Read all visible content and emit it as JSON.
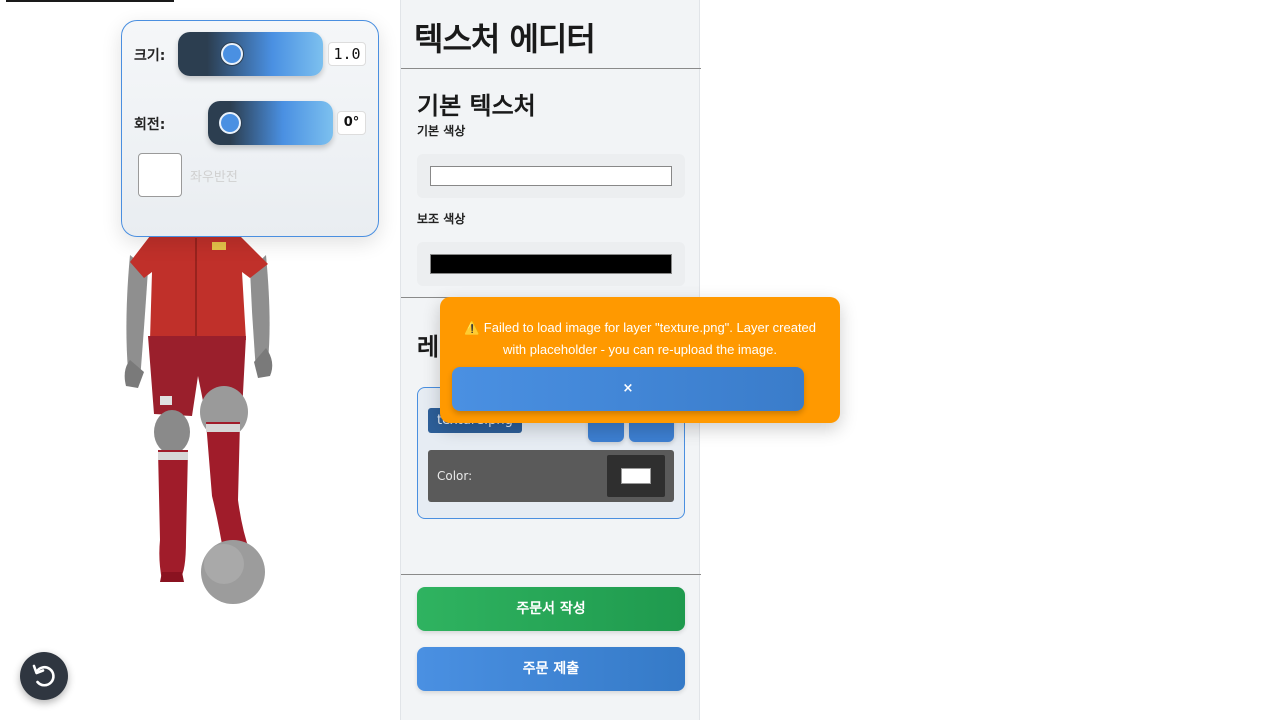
{
  "transform": {
    "size_label": "크기:",
    "size_value": "1.0",
    "rotation_label": "회전:",
    "rotation_value": "0°",
    "flip_label": "좌우반전",
    "size_level": 0.1,
    "rotation_level": 0.0
  },
  "editor": {
    "title": "텍스처 에디터",
    "base_section": {
      "title": "기본 텍스처",
      "primary_label": "기본 색상",
      "primary_color": "#ffffff",
      "secondary_label": "보조 색상",
      "secondary_color": "#000000"
    },
    "layers_section": {
      "title": "레이어",
      "layer": {
        "name": "texture.png",
        "color_label": "Color:",
        "color_value": "#ffffff"
      }
    },
    "order_button": "주문서 작성",
    "submit_button": "주문 제출"
  },
  "toast": {
    "icon": "warning-icon",
    "message": "⚠️ Failed to load image for layer \"texture.png\". Layer created with placeholder - you can re-upload the image.",
    "close_label": "×"
  },
  "colors": {
    "accent": "#4a90e2",
    "toast": "#ff9900",
    "order_green": "#2fb360",
    "jersey_red": "#c0302a",
    "sock_red": "#a01c2a"
  }
}
